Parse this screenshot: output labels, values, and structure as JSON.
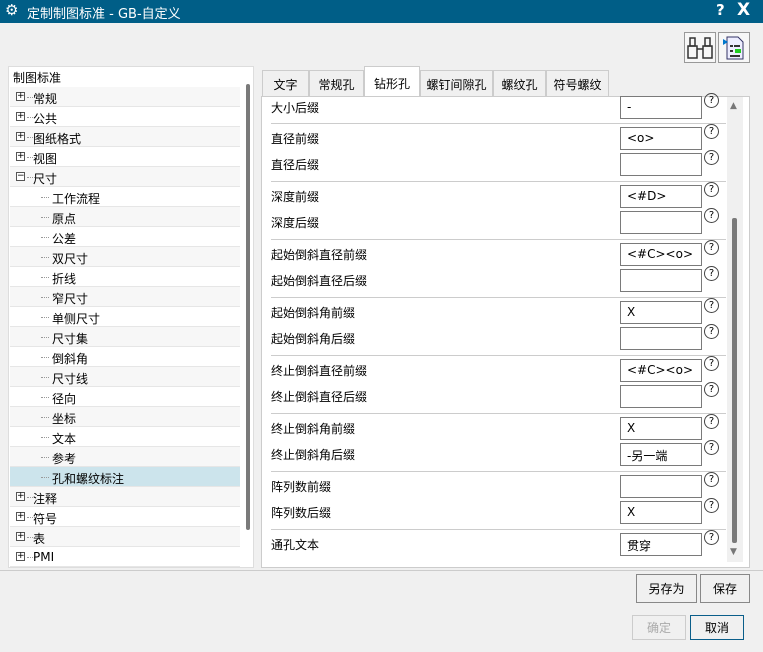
{
  "window": {
    "title": "定制制图标准 - GB-自定义",
    "help": "?",
    "close": "X"
  },
  "tree": {
    "header": "制图标准",
    "items": [
      {
        "label": "常规",
        "level": 0,
        "expander": "+"
      },
      {
        "label": "公共",
        "level": 0,
        "expander": "+"
      },
      {
        "label": "图纸格式",
        "level": 0,
        "expander": "+"
      },
      {
        "label": "视图",
        "level": 0,
        "expander": "+"
      },
      {
        "label": "尺寸",
        "level": 0,
        "expander": "−"
      },
      {
        "label": "工作流程",
        "level": 1
      },
      {
        "label": "原点",
        "level": 1
      },
      {
        "label": "公差",
        "level": 1
      },
      {
        "label": "双尺寸",
        "level": 1
      },
      {
        "label": "折线",
        "level": 1
      },
      {
        "label": "窄尺寸",
        "level": 1
      },
      {
        "label": "单侧尺寸",
        "level": 1
      },
      {
        "label": "尺寸集",
        "level": 1
      },
      {
        "label": "倒斜角",
        "level": 1
      },
      {
        "label": "尺寸线",
        "level": 1
      },
      {
        "label": "径向",
        "level": 1
      },
      {
        "label": "坐标",
        "level": 1
      },
      {
        "label": "文本",
        "level": 1
      },
      {
        "label": "参考",
        "level": 1
      },
      {
        "label": "孔和螺纹标注",
        "level": 1,
        "selected": true
      },
      {
        "label": "注释",
        "level": 0,
        "expander": "+"
      },
      {
        "label": "符号",
        "level": 0,
        "expander": "+"
      },
      {
        "label": "表",
        "level": 0,
        "expander": "+"
      },
      {
        "label": "PMI",
        "level": 0,
        "expander": "+"
      }
    ]
  },
  "tabs": [
    "文字",
    "常规孔",
    "钻形孔",
    "螺钉间隙孔",
    "螺纹孔",
    "符号螺纹"
  ],
  "active_tab": "钻形孔",
  "fields": [
    {
      "label": "大小后缀",
      "value": "-"
    },
    {
      "label": "直径前缀",
      "value": "<o>"
    },
    {
      "label": "直径后缀",
      "value": ""
    },
    {
      "label": "深度前缀",
      "value": "<#D>"
    },
    {
      "label": "深度后缀",
      "value": ""
    },
    {
      "label": "起始倒斜直径前缀",
      "value": "<#C><o>"
    },
    {
      "label": "起始倒斜直径后缀",
      "value": ""
    },
    {
      "label": "起始倒斜角前缀",
      "value": "X"
    },
    {
      "label": "起始倒斜角后缀",
      "value": ""
    },
    {
      "label": "终止倒斜直径前缀",
      "value": "<#C><o>"
    },
    {
      "label": "终止倒斜直径后缀",
      "value": ""
    },
    {
      "label": "终止倒斜角前缀",
      "value": "X"
    },
    {
      "label": "终止倒斜角后缀",
      "value": "-另一端"
    },
    {
      "label": "阵列数前缀",
      "value": ""
    },
    {
      "label": "阵列数后缀",
      "value": " X"
    },
    {
      "label": "通孔文本",
      "value": "贯穿"
    }
  ],
  "help_glyph": "?",
  "buttons": {
    "save_as": "另存为",
    "save": "保存",
    "ok": "确定",
    "cancel": "取消"
  }
}
